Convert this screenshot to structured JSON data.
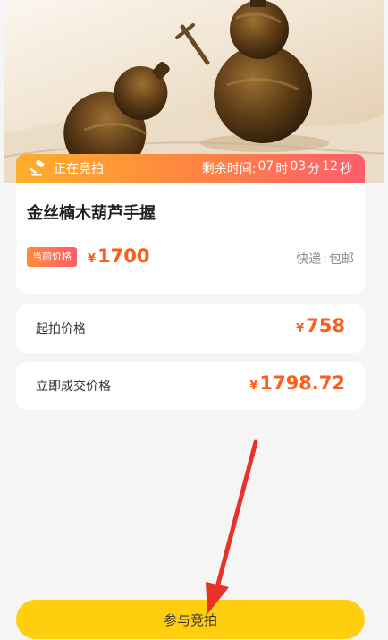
{
  "auction": {
    "status": "正在竞拍",
    "countdown_label": "剩余时间:",
    "hours": "07",
    "hours_unit": "时",
    "minutes": "03",
    "minutes_unit": "分",
    "seconds": "12",
    "seconds_unit": "秒"
  },
  "product": {
    "title": "金丝楠木葫芦手握",
    "price_tag": "当前价格",
    "currency": "¥",
    "current_price": "1700",
    "shipping_label": "快递",
    "shipping_sep": ":",
    "shipping_value": "包邮"
  },
  "starting_price": {
    "label": "起拍价格",
    "currency": "¥",
    "value": "758"
  },
  "buy_now_price": {
    "label": "立即成交价格",
    "currency": "¥",
    "value": "1798.72"
  },
  "bid_button": {
    "label": "参与竞拍"
  },
  "colors": {
    "accent_orange": "#ff5b1a",
    "button_yellow": "#ffcf0f",
    "annotation_red": "#e8322a"
  },
  "icons": {
    "auction": "gavel-icon",
    "annotation": "red-arrow-icon"
  }
}
